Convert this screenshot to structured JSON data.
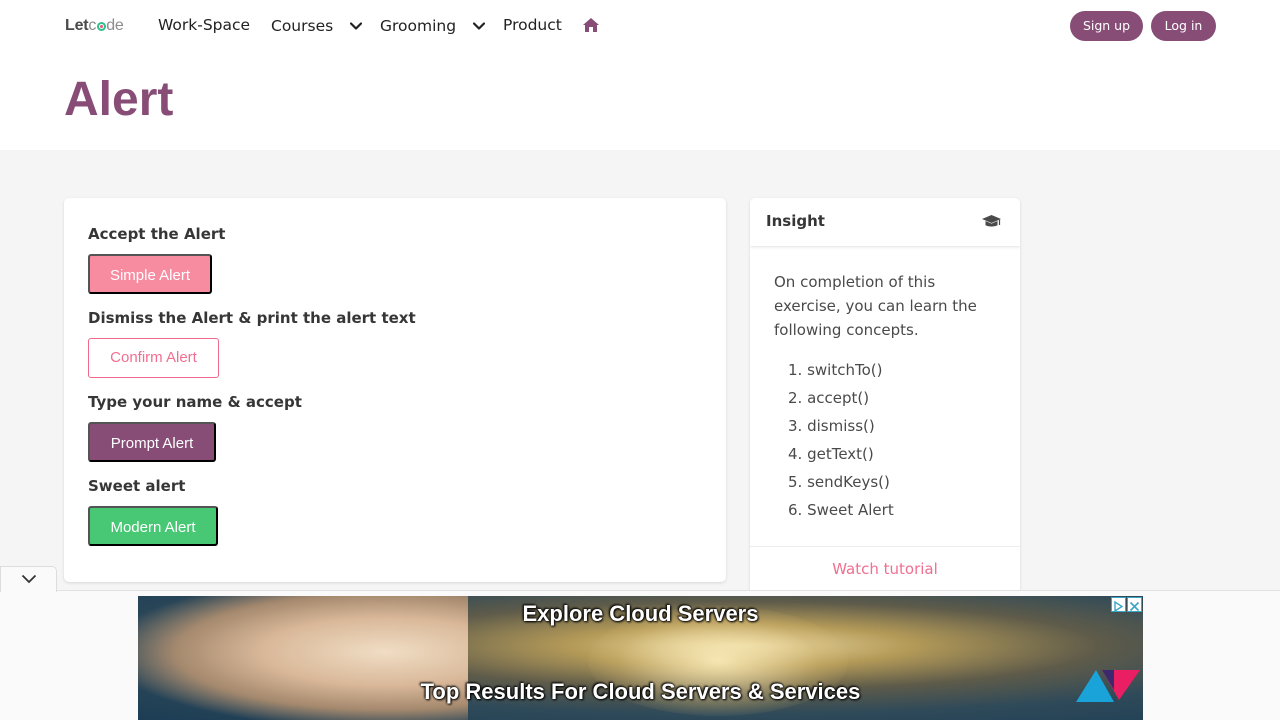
{
  "nav": {
    "logo": {
      "part1": "Let",
      "part2": "c",
      "part3": "de"
    },
    "items": [
      {
        "label": "Work-Space"
      },
      {
        "label": "Courses"
      },
      {
        "label": "Grooming"
      },
      {
        "label": "Product"
      }
    ],
    "signup": "Sign up",
    "login": "Log in",
    "accent": "#874d76"
  },
  "page": {
    "title": "Alert"
  },
  "alerts": [
    {
      "heading": "Accept the Alert",
      "button": "Simple Alert"
    },
    {
      "heading": "Dismiss the Alert & print the alert text",
      "button": "Confirm Alert"
    },
    {
      "heading": "Type your name & accept",
      "button": "Prompt Alert"
    },
    {
      "heading": "Sweet alert",
      "button": "Modern Alert"
    }
  ],
  "insight": {
    "title": "Insight",
    "intro": "On completion of this exercise, you can learn the following concepts.",
    "concepts": [
      "switchTo()",
      "accept()",
      "dismiss()",
      "getText()",
      "sendKeys()",
      "Sweet Alert"
    ],
    "link": "Watch tutorial"
  },
  "ad": {
    "headline": "Explore Cloud Servers",
    "subline": "Top Results For Cloud Servers & Services"
  },
  "colors": {
    "primary": "#874d76",
    "danger": "#f78ba0",
    "success": "#48c774",
    "link": "#f16f90"
  }
}
